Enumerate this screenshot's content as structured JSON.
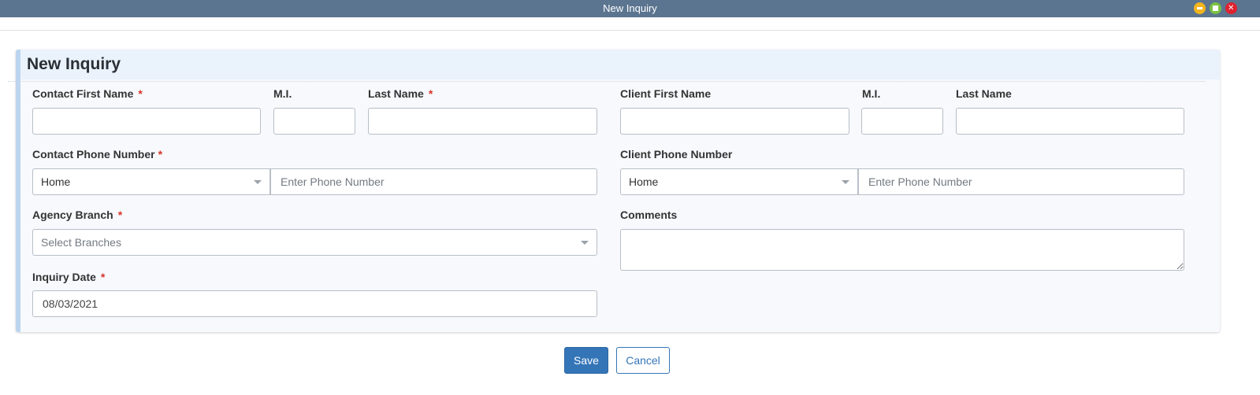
{
  "window": {
    "title": "New Inquiry"
  },
  "form": {
    "title": "New Inquiry",
    "required_mark": "*",
    "contact_first_name": {
      "label": "Contact First Name",
      "value": ""
    },
    "contact_mi": {
      "label": "M.I.",
      "value": ""
    },
    "contact_last_name": {
      "label": "Last Name",
      "value": ""
    },
    "client_first_name": {
      "label": "Client First Name",
      "value": ""
    },
    "client_mi": {
      "label": "M.I.",
      "value": ""
    },
    "client_last_name": {
      "label": "Last Name",
      "value": ""
    },
    "contact_phone": {
      "label": "Contact Phone Number",
      "type_value": "Home",
      "placeholder": "Enter Phone Number"
    },
    "client_phone": {
      "label": "Client Phone Number",
      "type_value": "Home",
      "placeholder": "Enter Phone Number"
    },
    "agency_branch": {
      "label": "Agency Branch",
      "placeholder": "Select Branches"
    },
    "comments": {
      "label": "Comments",
      "value": ""
    },
    "inquiry_date": {
      "label": "Inquiry Date",
      "value": "08/03/2021"
    }
  },
  "actions": {
    "save_label": "Save",
    "cancel_label": "Cancel"
  },
  "colors": {
    "titlebar": "#5b7590",
    "accent": "#3475b8",
    "required": "#d9342b",
    "panel_header": "#eaf2fc"
  }
}
